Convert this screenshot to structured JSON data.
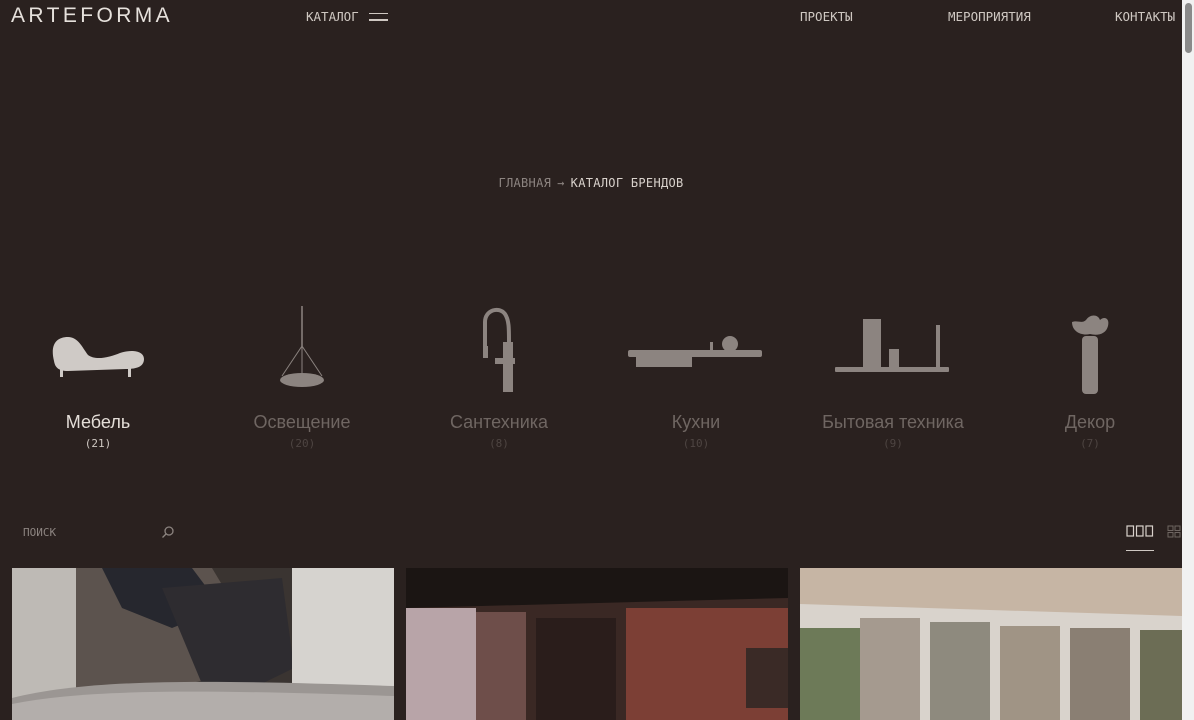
{
  "header": {
    "logo": "ARTEFORMA",
    "catalog_label": "КАТАЛОГ",
    "nav": [
      {
        "label": "ПРОЕКТЫ"
      },
      {
        "label": "МЕРОПРИЯТИЯ"
      },
      {
        "label": "КОНТАКТЫ"
      }
    ]
  },
  "breadcrumb": {
    "home": "ГЛАВНАЯ",
    "arrow": "→",
    "current": "КАТАЛОГ БРЕНДОВ"
  },
  "categories": [
    {
      "label": "Мебель",
      "count": "(21)",
      "icon": "sofa-icon",
      "active": true
    },
    {
      "label": "Освещение",
      "count": "(20)",
      "icon": "pendant-lamp-icon",
      "active": false
    },
    {
      "label": "Сантехника",
      "count": "(8)",
      "icon": "faucet-icon",
      "active": false
    },
    {
      "label": "Кухни",
      "count": "(10)",
      "icon": "kitchen-icon",
      "active": false
    },
    {
      "label": "Бытовая техника",
      "count": "(9)",
      "icon": "appliances-icon",
      "active": false
    },
    {
      "label": "Декор",
      "count": "(7)",
      "icon": "vase-icon",
      "active": false
    }
  ],
  "search": {
    "placeholder": "ПОИСК"
  },
  "view_modes": [
    "list-view-icon",
    "grid-view-icon"
  ],
  "colors": {
    "background": "#2a211f",
    "text": "#d9d2cc",
    "muted": "#6f6662"
  }
}
